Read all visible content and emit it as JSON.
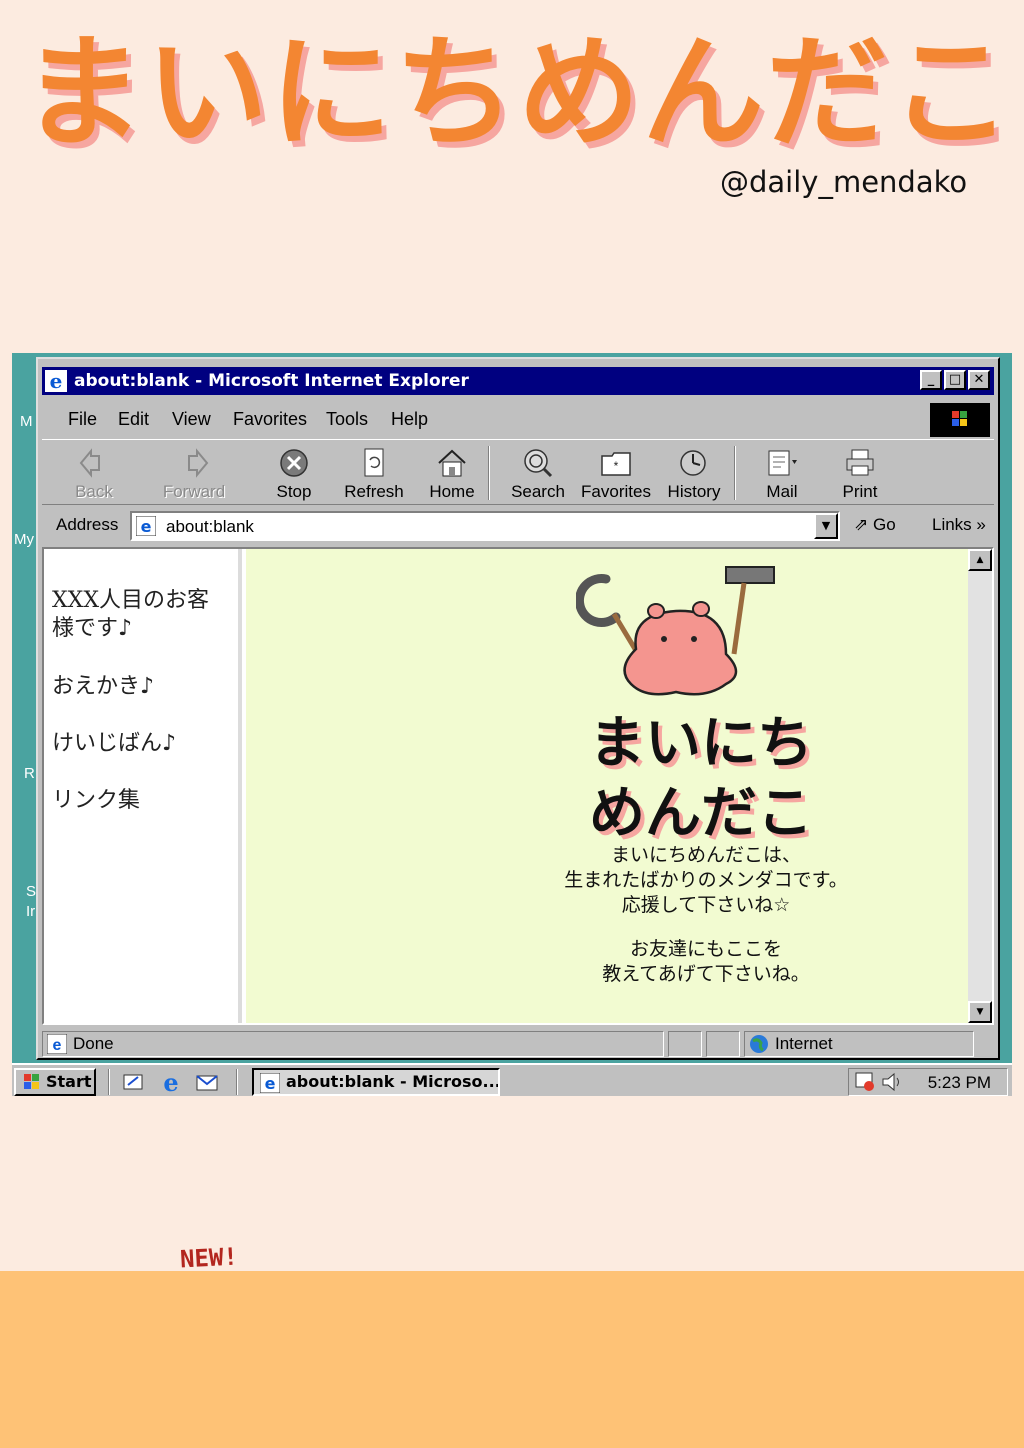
{
  "poster": {
    "title": "まいにちめんだこ",
    "handle": "@daily_mendako",
    "new_tag": "NEW!"
  },
  "desktop": {
    "icon_labels": [
      "M",
      "My",
      "R",
      "S",
      "Ir"
    ]
  },
  "window": {
    "title": "about:blank - Microsoft Internet Explorer",
    "controls": {
      "minimize": "_",
      "maximize": "□",
      "close": "✕"
    }
  },
  "menu": [
    "File",
    "Edit",
    "View",
    "Favorites",
    "Tools",
    "Help"
  ],
  "toolbar": {
    "back": "Back",
    "forward": "Forward",
    "stop": "Stop",
    "refresh": "Refresh",
    "home": "Home",
    "search": "Search",
    "favorites": "Favorites",
    "history": "History",
    "mail": "Mail",
    "print": "Print"
  },
  "address": {
    "label": "Address",
    "value": "about:blank",
    "go": "Go",
    "links": "Links"
  },
  "nav": {
    "visitor": "XXX人目のお客様です♪",
    "oekaki": "おえかき♪",
    "bbs": "けいじばん♪",
    "links": "リンク集"
  },
  "site": {
    "logo_line1": "まいにち",
    "logo_line2": "めんだこ",
    "desc_line1": "まいにちめんだこは、",
    "desc_line2": "生まれたばかりのメンダコです。",
    "desc_line3": "応援して下さいね☆",
    "desc_line4": "お友達にもここを",
    "desc_line5": "教えてあげて下さいね。"
  },
  "status": {
    "text": "Done",
    "zone": "Internet"
  },
  "taskbar": {
    "start": "Start",
    "task": "about:blank - Microso...",
    "clock": "5:23 PM"
  }
}
